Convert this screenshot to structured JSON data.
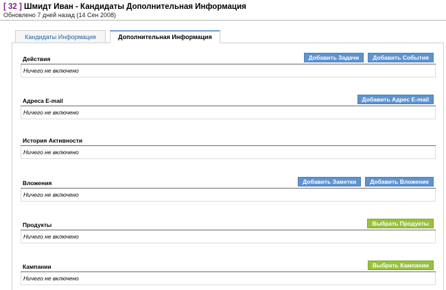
{
  "header": {
    "record_id": "[ 32 ]",
    "title": " Шмидт Иван - Кандидаты Дополнительная Информация",
    "subtitle": "Обновлено 7 дней назад (14 Сен 2008)"
  },
  "tabs": [
    {
      "label": "Кандидаты Информация"
    },
    {
      "label": "Дополнительная Информация"
    }
  ],
  "sections": {
    "actions": {
      "title": "Действия",
      "empty": "Ничего не включено",
      "btn1": "Добавить Задачи",
      "btn2": "Добавить События"
    },
    "emails": {
      "title": "Адреса E-mail",
      "empty": "Ничего не включено",
      "btn1": "Добавить Адрес E-mail"
    },
    "history": {
      "title": "История Активности",
      "empty": "Ничего не включено"
    },
    "attachments": {
      "title": "Вложения",
      "empty": "Ничего не включено",
      "btn1": "Добавить Заметки",
      "btn2": "Добавить Вложение"
    },
    "products": {
      "title": "Продукты",
      "empty": "Ничего не включено",
      "btn1": "Выбрать Продукты"
    },
    "campaigns": {
      "title": "Кампании",
      "empty": "Ничего не включено",
      "btn1": "Выбрать Кампании"
    }
  },
  "colors": {
    "accent_blue": "#5d93cf",
    "accent_green": "#97c23c",
    "record_id": "#7b1e8a"
  }
}
